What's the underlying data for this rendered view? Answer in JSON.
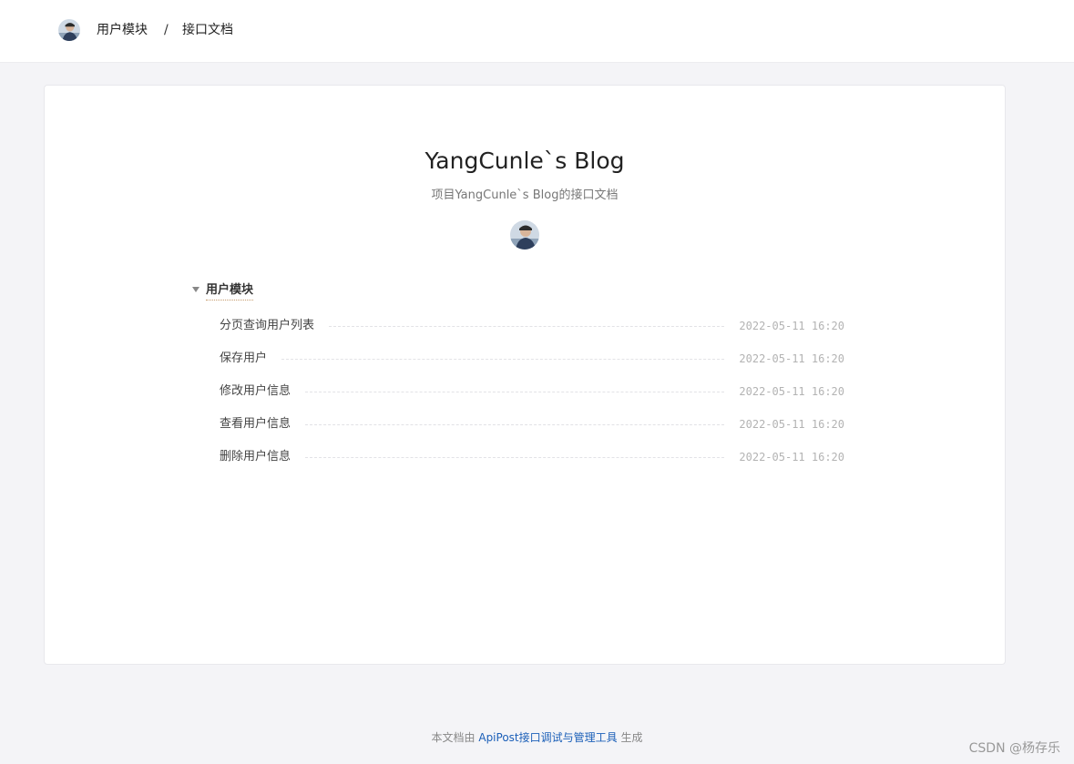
{
  "header": {
    "avatar_icon": "user-avatar-icon",
    "breadcrumb": [
      {
        "label": "用户模块"
      },
      {
        "label": "/"
      },
      {
        "label": "接口文档"
      }
    ]
  },
  "project": {
    "title": "YangCunle`s Blog",
    "subtitle": "项目YangCunle`s Blog的接口文档",
    "avatar_icon": "user-avatar-icon"
  },
  "groups": [
    {
      "title": "用户模块",
      "expanded": true,
      "items": [
        {
          "name": "分页查询用户列表",
          "time": "2022-05-11 16:20"
        },
        {
          "name": "保存用户",
          "time": "2022-05-11 16:20"
        },
        {
          "name": "修改用户信息",
          "time": "2022-05-11 16:20"
        },
        {
          "name": "查看用户信息",
          "time": "2022-05-11 16:20"
        },
        {
          "name": "删除用户信息",
          "time": "2022-05-11 16:20"
        }
      ]
    }
  ],
  "footer": {
    "prefix": "本文档由 ",
    "link_text": "ApiPost接口调试与管理工具",
    "suffix": " 生成"
  },
  "watermark": "CSDN @杨存乐",
  "colors": {
    "page_bg": "#f4f4f7",
    "link": "#1b5fb8",
    "timestamp": "#b3b3b3"
  }
}
